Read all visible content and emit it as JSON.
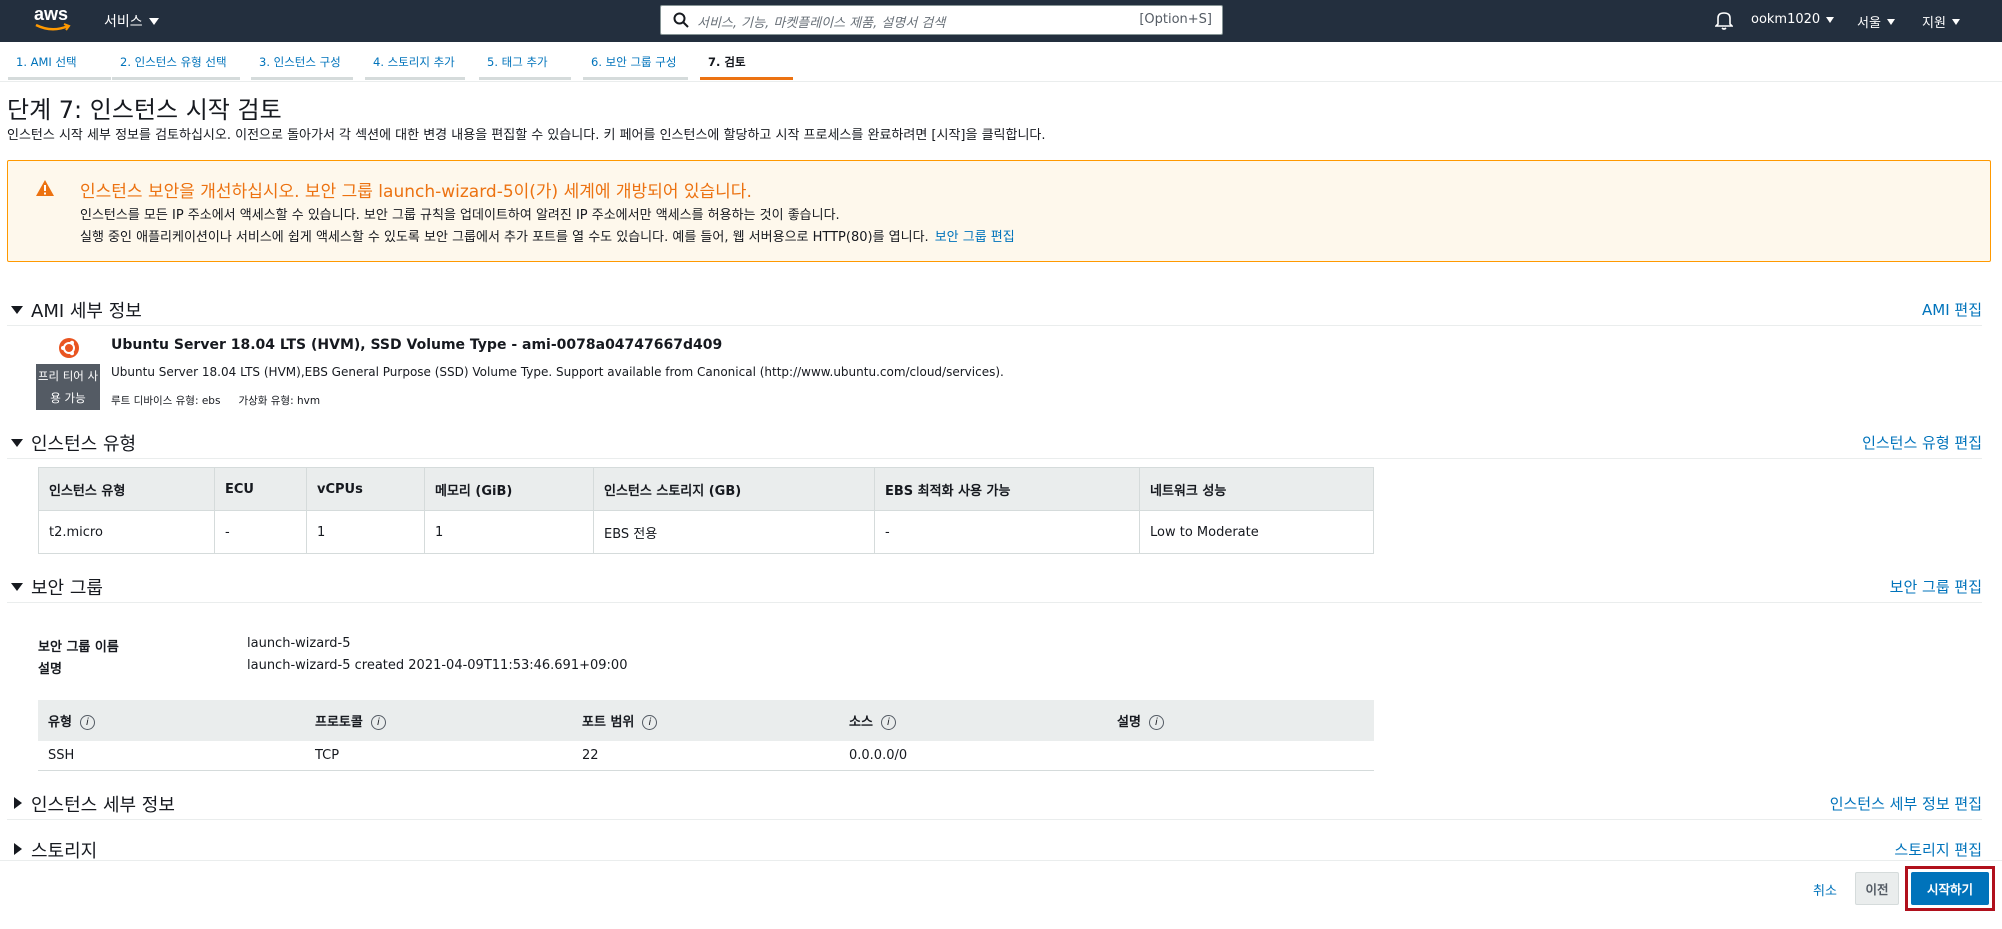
{
  "nav": {
    "logo": "aws",
    "services": "서비스",
    "search_placeholder": "서비스, 기능, 마켓플레이스 제품, 설명서 검색",
    "search_shortcut": "[Option+S]",
    "user": "ookm1020",
    "region": "서울",
    "support": "지원"
  },
  "steps": [
    {
      "label": "1. AMI 선택"
    },
    {
      "label": "2. 인스턴스 유형 선택"
    },
    {
      "label": "3. 인스턴스 구성"
    },
    {
      "label": "4. 스토리지 추가"
    },
    {
      "label": "5. 태그 추가"
    },
    {
      "label": "6. 보안 그룹 구성"
    },
    {
      "label": "7. 검토"
    }
  ],
  "page": {
    "title": "단계 7: 인스턴스 시작 검토",
    "description": "인스턴스 시작 세부 정보를 검토하십시오. 이전으로 돌아가서 각 섹션에 대한 변경 내용을 편집할 수 있습니다. 키 페어를 인스턴스에 할당하고 시작 프로세스를 완료하려면 [시작]을 클릭합니다."
  },
  "warning": {
    "title": "인스턴스 보안을 개선하십시오. 보안 그룹 launch-wizard-5이(가) 세계에 개방되어 있습니다.",
    "line1": "인스턴스를 모든 IP 주소에서 액세스할 수 있습니다. 보안 그룹 규칙을 업데이트하여 알려진 IP 주소에서만 액세스를 허용하는 것이 좋습니다.",
    "line2": "실행 중인 애플리케이션이나 서비스에 쉽게 액세스할 수 있도록 보안 그룹에서 추가 포트를 열 수도 있습니다. 예를 들어, 웹 서버용으로 HTTP(80)를 엽니다.",
    "link": "보안 그룹 편집",
    "color": "#ec7211"
  },
  "ami": {
    "section_title": "AMI 세부 정보",
    "edit": "AMI 편집",
    "badge": "프리 티어 사용 가능",
    "name": "Ubuntu Server 18.04 LTS (HVM), SSD Volume Type - ami-0078a04747667d409",
    "description": "Ubuntu Server 18.04 LTS (HVM),EBS General Purpose (SSD) Volume Type. Support available from Canonical (http://www.ubuntu.com/cloud/services).",
    "root_device": "루트 디바이스 유형: ebs",
    "virtualization": "가상화 유형: hvm",
    "icon": "ubuntu-logo-icon"
  },
  "instance_type": {
    "section_title": "인스턴스 유형",
    "edit": "인스턴스 유형 편집",
    "headers": [
      "인스턴스 유형",
      "ECU",
      "vCPUs",
      "메모리 (GiB)",
      "인스턴스 스토리지 (GB)",
      "EBS 최적화 사용 가능",
      "네트워크 성능"
    ],
    "row": [
      "t2.micro",
      "-",
      "1",
      "1",
      "EBS 전용",
      "-",
      "Low to Moderate"
    ]
  },
  "security_group": {
    "section_title": "보안 그룹",
    "edit": "보안 그룹 편집",
    "name_label": "보안 그룹 이름",
    "name_value": "launch-wizard-5",
    "desc_label": "설명",
    "desc_value": "launch-wizard-5 created 2021-04-09T11:53:46.691+09:00",
    "headers": [
      "유형",
      "프로토콜",
      "포트 범위",
      "소스",
      "설명"
    ],
    "info_glyph": "i",
    "row": [
      "SSH",
      "TCP",
      "22",
      "0.0.0.0/0",
      ""
    ]
  },
  "instance_details": {
    "section_title": "인스턴스 세부 정보",
    "edit": "인스턴스 세부 정보 편집"
  },
  "storage": {
    "section_title": "스토리지",
    "edit": "스토리지 편집"
  },
  "footer": {
    "cancel": "취소",
    "previous": "이전",
    "launch": "시작하기",
    "launch_color": "#0073bb",
    "highlight_color": "#b0101c"
  }
}
